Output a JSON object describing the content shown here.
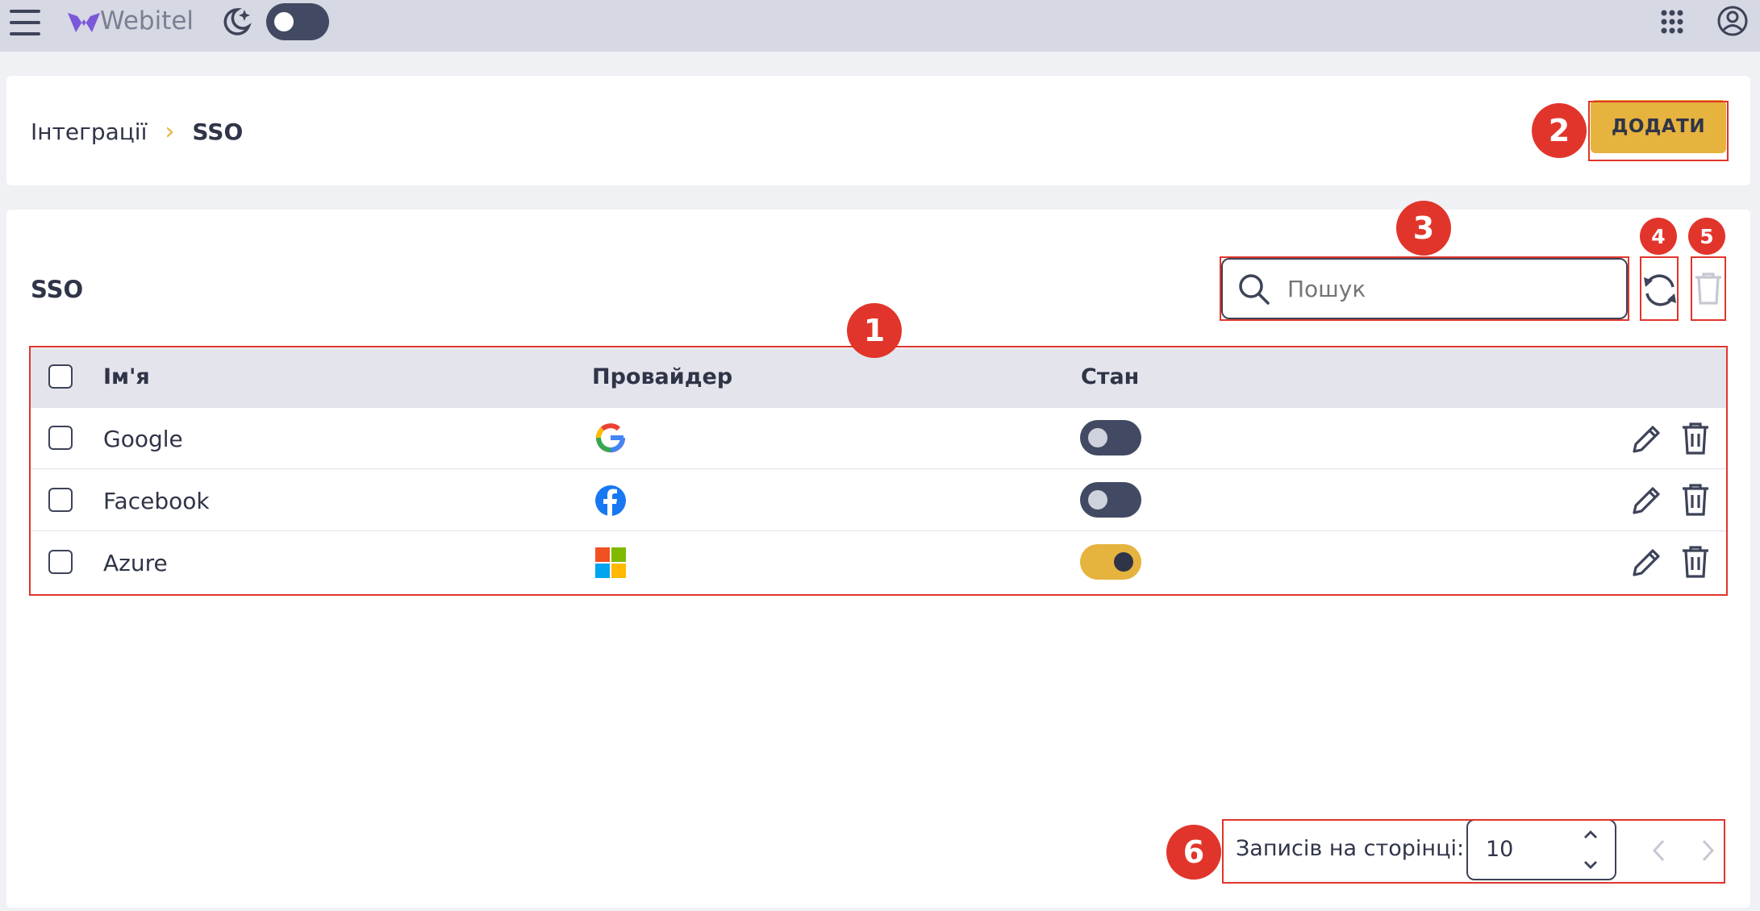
{
  "topbar": {
    "logo_text": "Webitel",
    "icons": [
      "menu-icon",
      "moon-icon",
      "apps-grid-icon",
      "account-icon"
    ],
    "theme_toggle_on": false
  },
  "header": {
    "breadcrumb_parent": "Інтеграції",
    "breadcrumb_separator": "›",
    "breadcrumb_current": "SSO",
    "add_button_label": "ДОДАТИ"
  },
  "main": {
    "section_title": "SSO",
    "search": {
      "placeholder": "Пошук",
      "value": ""
    },
    "columns": {
      "name": "Ім'я",
      "provider": "Провайдер",
      "state": "Стан"
    },
    "rows": [
      {
        "name": "Google",
        "provider_icon": "google-icon",
        "enabled": false
      },
      {
        "name": "Facebook",
        "provider_icon": "facebook-icon",
        "enabled": false
      },
      {
        "name": "Azure",
        "provider_icon": "microsoft-icon",
        "enabled": true
      }
    ]
  },
  "pagination": {
    "per_page_label": "Записів на сторінці:",
    "per_page_value": "10"
  },
  "markers": [
    "1",
    "2",
    "3",
    "4",
    "5",
    "6"
  ],
  "colors": {
    "accent": "#e6b33e",
    "topbar_bg": "#d6d8e3",
    "table_header_bg": "#e4e5ec",
    "annotation_red": "#e1352b",
    "toggle_off": "#424a63"
  }
}
